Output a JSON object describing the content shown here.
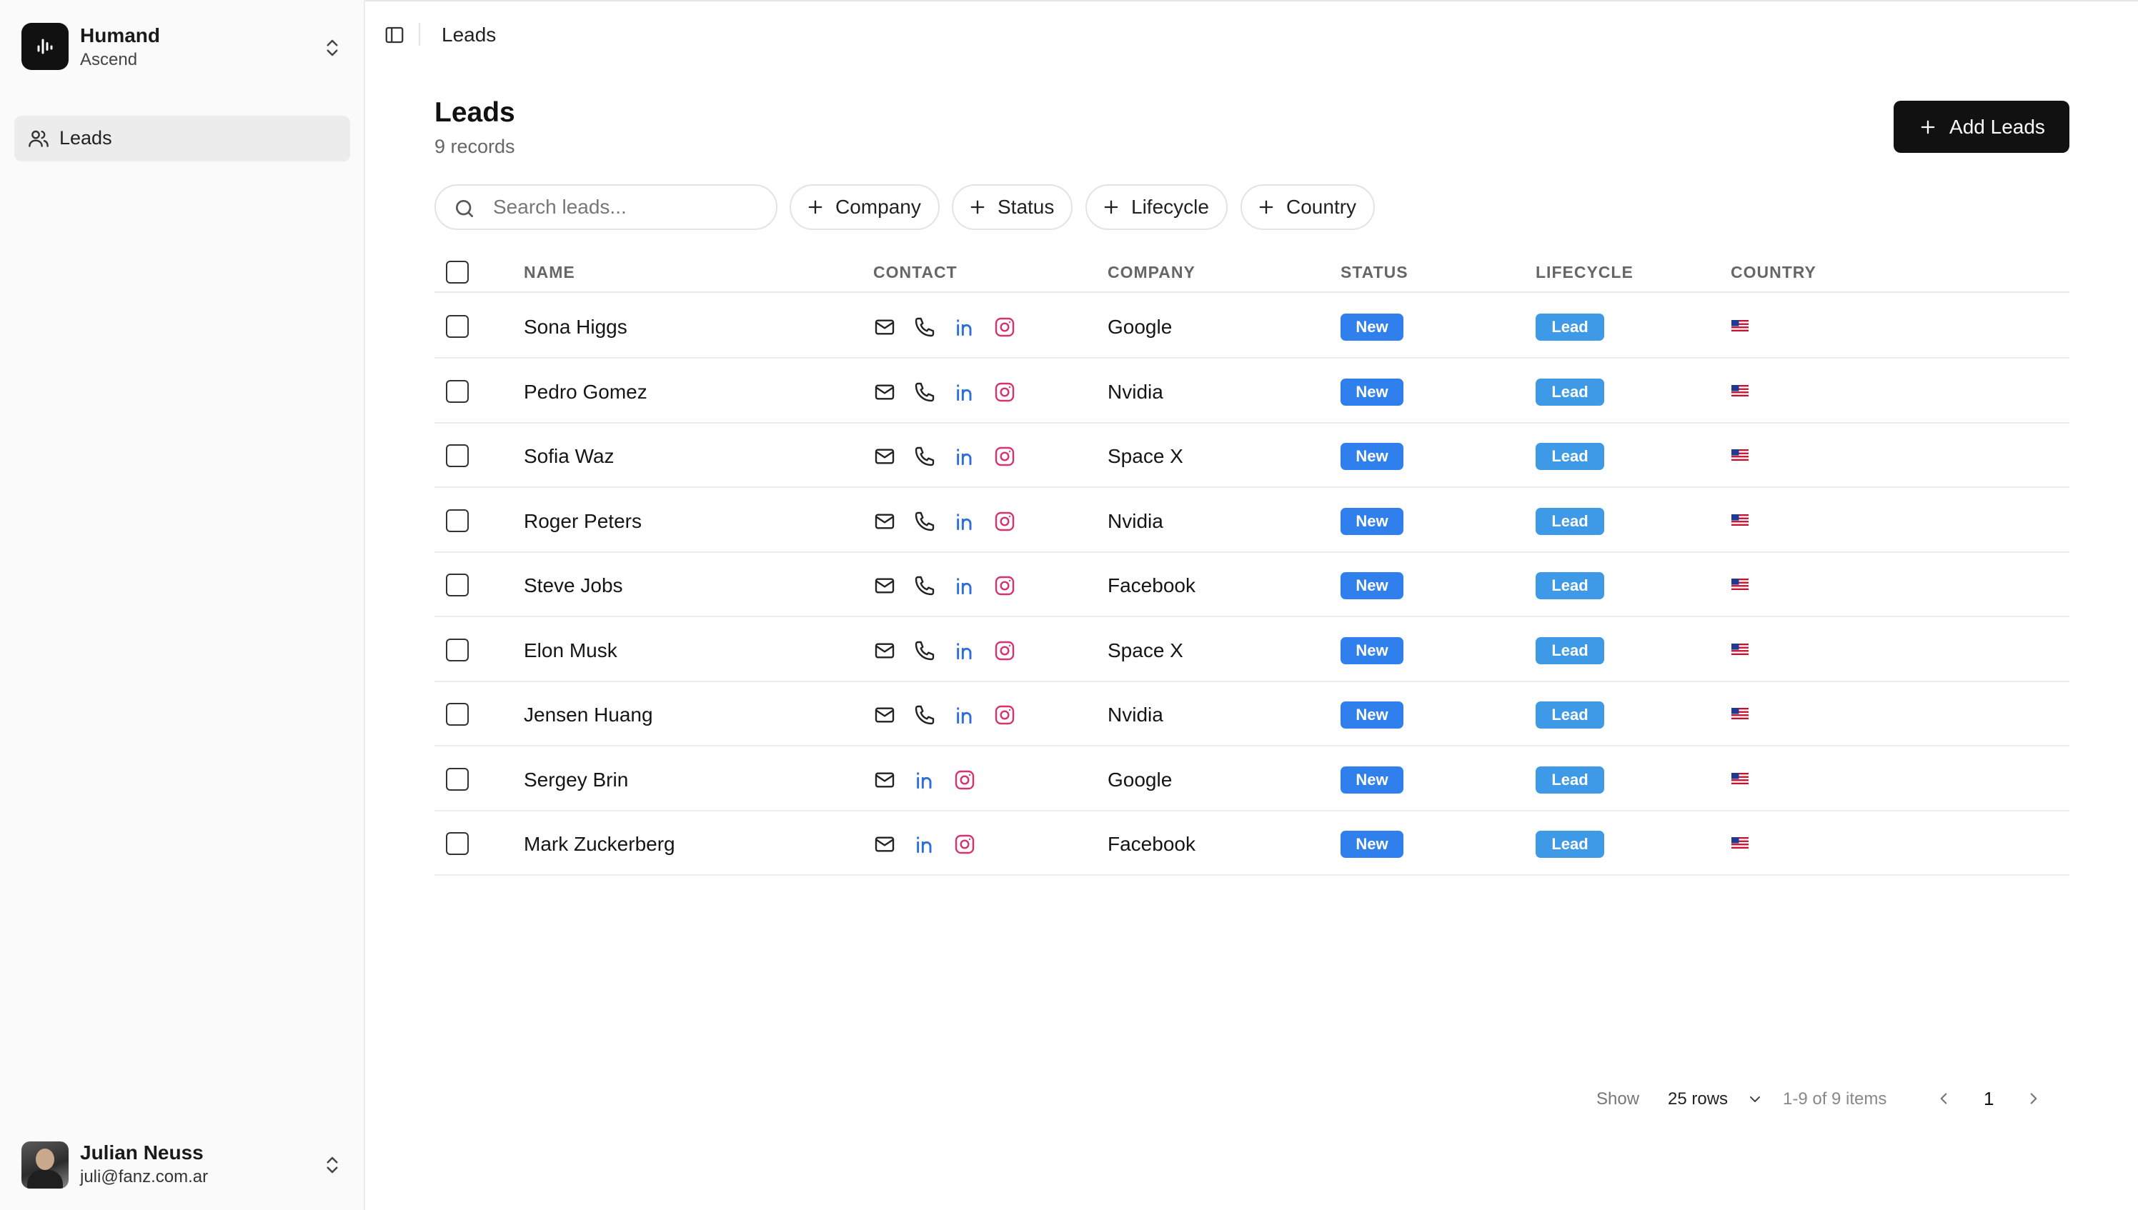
{
  "sidebar": {
    "workspace": {
      "name": "Humand",
      "sub": "Ascend"
    },
    "nav": [
      {
        "label": "Leads",
        "icon": "users-icon",
        "active": true
      }
    ],
    "user": {
      "name": "Julian Neuss",
      "email": "juli@fanz.com.ar"
    }
  },
  "header": {
    "breadcrumb": "Leads"
  },
  "page": {
    "title": "Leads",
    "subtitle": "9 records",
    "add_button": "Add Leads"
  },
  "filters": {
    "search_placeholder": "Search leads...",
    "chips": [
      "Company",
      "Status",
      "Lifecycle",
      "Country"
    ]
  },
  "table": {
    "columns": [
      "NAME",
      "CONTACT",
      "COMPANY",
      "STATUS",
      "LIFECYCLE",
      "COUNTRY"
    ],
    "rows": [
      {
        "name": "Sona Higgs",
        "company": "Google",
        "status": "New",
        "lifecycle": "Lead",
        "country": "us-flag",
        "contact": [
          "email",
          "phone",
          "linkedin",
          "instagram"
        ]
      },
      {
        "name": "Pedro Gomez",
        "company": "Nvidia",
        "status": "New",
        "lifecycle": "Lead",
        "country": "us-flag",
        "contact": [
          "email",
          "phone",
          "linkedin",
          "instagram"
        ]
      },
      {
        "name": "Sofia Waz",
        "company": "Space X",
        "status": "New",
        "lifecycle": "Lead",
        "country": "us-flag",
        "contact": [
          "email",
          "phone",
          "linkedin",
          "instagram"
        ]
      },
      {
        "name": "Roger Peters",
        "company": "Nvidia",
        "status": "New",
        "lifecycle": "Lead",
        "country": "us-flag",
        "contact": [
          "email",
          "phone",
          "linkedin",
          "instagram"
        ]
      },
      {
        "name": "Steve Jobs",
        "company": "Facebook",
        "status": "New",
        "lifecycle": "Lead",
        "country": "us-flag",
        "contact": [
          "email",
          "phone",
          "linkedin",
          "instagram"
        ]
      },
      {
        "name": "Elon Musk",
        "company": "Space X",
        "status": "New",
        "lifecycle": "Lead",
        "country": "us-flag",
        "contact": [
          "email",
          "phone",
          "linkedin",
          "instagram"
        ]
      },
      {
        "name": "Jensen Huang",
        "company": "Nvidia",
        "status": "New",
        "lifecycle": "Lead",
        "country": "us-flag",
        "contact": [
          "email",
          "phone",
          "linkedin",
          "instagram"
        ]
      },
      {
        "name": "Sergey Brin",
        "company": "Google",
        "status": "New",
        "lifecycle": "Lead",
        "country": "us-flag",
        "contact": [
          "email",
          "linkedin",
          "instagram"
        ]
      },
      {
        "name": "Mark Zuckerberg",
        "company": "Facebook",
        "status": "New",
        "lifecycle": "Lead",
        "country": "us-flag",
        "contact": [
          "email",
          "linkedin",
          "instagram"
        ]
      }
    ]
  },
  "pagination": {
    "show_label": "Show",
    "rows_value": "25 rows",
    "range": "1-9 of 9 items",
    "page": "1"
  },
  "colors": {
    "status_badge": "#2f80ed",
    "lifecycle_badge": "#3e9ae6",
    "primary_button": "#111111",
    "linkedin": "#2f6fd6",
    "instagram": "#d6336c"
  }
}
